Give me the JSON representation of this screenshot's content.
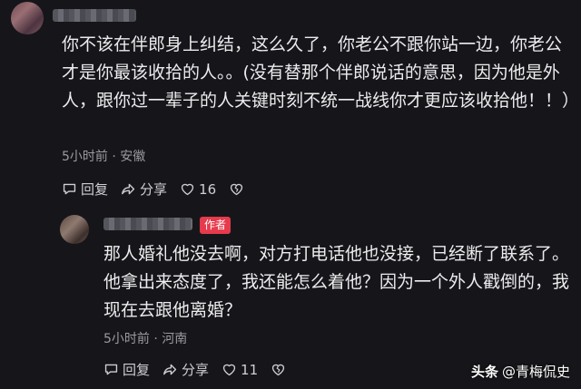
{
  "comment": {
    "text": "你不该在伴郎身上纠结，这么久了，你老公不跟你站一边，你老公才是你最该收拾的人。。(没有替那个伴郎说话的意思，因为他是外人，跟你过一辈子的人关键时刻不统一战线你才更应该收拾他！！）",
    "time": "5小时前",
    "location": "安徽",
    "reply_label": "回复",
    "share_label": "分享",
    "like_count": "16",
    "icons": [
      "reply-icon",
      "share-icon",
      "heart-icon",
      "broken-heart-icon"
    ]
  },
  "reply": {
    "author_badge": "作者",
    "text": "那人婚礼他没去啊，对方打电话他也没接，已经断了联系了。他拿出来态度了，我还能怎么着他？因为一个外人戳倒的，我现在去跟他离婚？",
    "time": "5小时前",
    "location": "河南",
    "reply_label": "回复",
    "share_label": "分享",
    "like_count": "11"
  },
  "meta_separator": " · ",
  "watermark": {
    "brand": "头条",
    "handle": "@青梅侃史"
  },
  "colors": {
    "background": "#16161a",
    "text": "#ececee",
    "muted": "#9a9aa0",
    "badge": "#e53b4c"
  }
}
